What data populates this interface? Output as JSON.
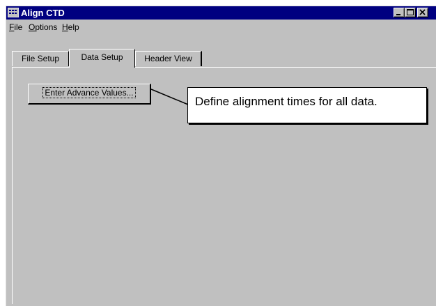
{
  "window": {
    "title": "Align CTD"
  },
  "menu": [
    {
      "label_mnemonic": "F",
      "label_rest": "ile"
    },
    {
      "label_mnemonic": "O",
      "label_rest": "ptions"
    },
    {
      "label_mnemonic": "H",
      "label_rest": "elp"
    }
  ],
  "tabs": [
    {
      "label": "File Setup",
      "active": false
    },
    {
      "label": "Data Setup",
      "active": true
    },
    {
      "label": "Header View",
      "active": false
    }
  ],
  "data_setup": {
    "advance_button_label": "Enter Advance Values..."
  },
  "callout": {
    "text": "Define alignment times for all data."
  },
  "colors": {
    "titlebar": "#000080",
    "face": "#c0c0c0",
    "highlight": "#ffffff",
    "shadow": "#808080"
  },
  "icons": [
    "app-icon",
    "minimize-icon",
    "maximize-icon",
    "close-icon"
  ]
}
